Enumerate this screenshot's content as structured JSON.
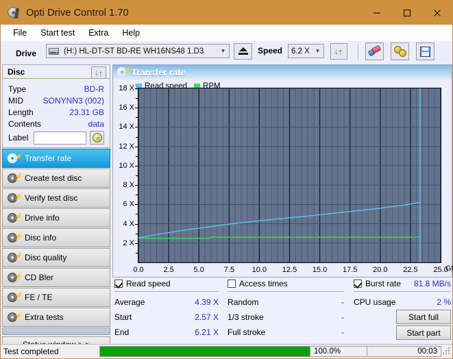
{
  "window": {
    "title": "Opti Drive Control 1.70",
    "icon": "optical-disc-icon",
    "minimize": "minimize-icon",
    "maximize": "maximize-icon",
    "close": "close-icon"
  },
  "menubar": {
    "items": [
      {
        "label": "File"
      },
      {
        "label": "Start test"
      },
      {
        "label": "Extra"
      },
      {
        "label": "Help"
      }
    ]
  },
  "toolbar": {
    "drive_label": "Drive",
    "drive_value": "(H:)   HL-DT-ST BD-RE  WH16NS48 1.D3",
    "eject_icon": "eject-icon",
    "speed_label": "Speed",
    "speed_value": "6.2 X",
    "refresh_icon": "refresh-icon",
    "erase_icon": "eraser-icon",
    "settings_icon": "gears-icon",
    "save_icon": "floppy-save-icon"
  },
  "disc_panel": {
    "header": "Disc",
    "refresh_icon": "refresh-icon",
    "rows": [
      {
        "key": "Type",
        "value": "BD-R"
      },
      {
        "key": "MID",
        "value": "SONYNN3 (002)"
      },
      {
        "key": "Length",
        "value": "23.31 GB"
      },
      {
        "key": "Contents",
        "value": "data"
      }
    ],
    "label_key": "Label",
    "label_value": "",
    "label_placeholder": "",
    "label_button_icon": "cd-icon"
  },
  "sidebar": {
    "items": [
      {
        "label": "Transfer rate",
        "icon": "disc-test-icon",
        "active": true
      },
      {
        "label": "Create test disc",
        "icon": "disc-test-icon",
        "active": false
      },
      {
        "label": "Verify test disc",
        "icon": "disc-test-icon",
        "active": false
      },
      {
        "label": "Drive info",
        "icon": "disc-test-icon",
        "active": false
      },
      {
        "label": "Disc info",
        "icon": "disc-test-icon",
        "active": false
      },
      {
        "label": "Disc quality",
        "icon": "disc-test-icon",
        "active": false
      },
      {
        "label": "CD Bler",
        "icon": "disc-test-icon",
        "active": false
      },
      {
        "label": "FE / TE",
        "icon": "disc-test-icon",
        "active": false
      },
      {
        "label": "Extra tests",
        "icon": "disc-test-icon",
        "active": false
      }
    ],
    "status_window_button": "Status window > >"
  },
  "chart_panel": {
    "title": "Transfer rate",
    "title_icon": "disc-test-icon",
    "x_unit": "GB"
  },
  "chart_data": {
    "type": "line",
    "title": "Transfer rate",
    "xlabel": "GB",
    "ylabel": "X",
    "xlim": [
      0.0,
      25.0
    ],
    "ylim": [
      0,
      18
    ],
    "xticks": [
      "0.0",
      "2.5",
      "5.0",
      "7.5",
      "10.0",
      "12.5",
      "15.0",
      "17.5",
      "20.0",
      "22.5",
      "25.0"
    ],
    "xtick_values": [
      0.0,
      2.5,
      5.0,
      7.5,
      10.0,
      12.5,
      15.0,
      17.5,
      20.0,
      22.5,
      25.0
    ],
    "yticks": [
      "2 X",
      "4 X",
      "6 X",
      "8 X",
      "10 X",
      "12 X",
      "14 X",
      "16 X",
      "18 X"
    ],
    "ytick_values": [
      2,
      4,
      6,
      8,
      10,
      12,
      14,
      16,
      18
    ],
    "grid": true,
    "legend": [
      {
        "name": "Read speed",
        "color": "#55c6f5"
      },
      {
        "name": "RPM",
        "color": "#2ae64a"
      }
    ],
    "legend_position": "top-left",
    "plot_bg": "#64748f",
    "series": [
      {
        "name": "Read speed",
        "color": "#55c6f5",
        "x": [
          0.0,
          0.3,
          0.8,
          1.5,
          2.5,
          3.5,
          5.0,
          6.5,
          8.0,
          10.0,
          12.0,
          14.0,
          16.0,
          18.0,
          20.0,
          22.0,
          23.3
        ],
        "y": [
          2.57,
          2.6,
          2.72,
          2.88,
          3.08,
          3.28,
          3.54,
          3.8,
          4.03,
          4.3,
          4.56,
          4.8,
          5.06,
          5.33,
          5.6,
          5.93,
          6.21
        ]
      },
      {
        "name": "RPM",
        "color": "#2ae64a",
        "x": [
          0.0,
          5.9,
          6.0,
          23.3
        ],
        "y": [
          2.5,
          2.5,
          2.62,
          2.62
        ]
      }
    ],
    "markers": [
      {
        "name": "disc-end-marker",
        "type": "vline",
        "x": 23.3,
        "color": "#55c6f5"
      }
    ]
  },
  "stats": {
    "read_speed": {
      "checkbox_label": "Read speed",
      "checked": true,
      "rows": [
        {
          "key": "Average",
          "value": "4.39 X"
        },
        {
          "key": "Start",
          "value": "2.57 X"
        },
        {
          "key": "End",
          "value": "6.21 X"
        }
      ]
    },
    "access_times": {
      "checkbox_label": "Access times",
      "checked": false,
      "rows": [
        {
          "key": "Random",
          "value": "-"
        },
        {
          "key": "1/3 stroke",
          "value": "-"
        },
        {
          "key": "Full stroke",
          "value": "-"
        }
      ]
    },
    "burst_rate": {
      "checkbox_label": "Burst rate",
      "checked": true,
      "value": "81.8 MB/s",
      "rows": [
        {
          "key": "CPU usage",
          "value": "2 %"
        }
      ]
    },
    "buttons": [
      {
        "label": "Start full"
      },
      {
        "label": "Start part"
      }
    ]
  },
  "statusbar": {
    "text": "Test completed",
    "progress_percent": "100.0%",
    "progress_value": 100,
    "elapsed": "00:03",
    "grip_icon": "resize-grip-icon"
  }
}
